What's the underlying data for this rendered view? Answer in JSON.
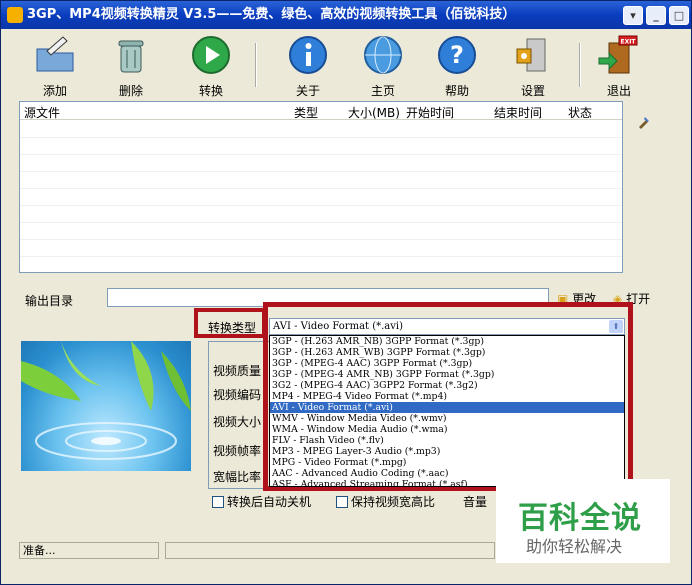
{
  "window": {
    "title": "3GP、MP4视频转换精灵 V3.5——免费、绿色、高效的视频转换工具（佰锐科技）"
  },
  "toolbar": {
    "add": "添加",
    "delete": "删除",
    "convert": "转换",
    "about": "关于",
    "home": "主页",
    "help": "帮助",
    "settings": "设置",
    "exit": "退出",
    "exit_sign": "EXIT"
  },
  "filelist": {
    "columns": [
      "源文件",
      "类型",
      "大小(MB)",
      "开始时间",
      "结束时间",
      "状态"
    ],
    "rows": []
  },
  "output": {
    "label": "输出目录",
    "value": "",
    "change": "更改",
    "open": "打开"
  },
  "conversion": {
    "type_label": "转换类型",
    "selected": "AVI - Video Format (*.avi)",
    "options": [
      "3GP - (H.263 AMR_NB) 3GPP Format (*.3gp)",
      "3GP - (H.263 AMR_WB) 3GPP Format (*.3gp)",
      "3GP - (MPEG-4 AAC) 3GPP Format (*.3gp)",
      "3GP - (MPEG-4 AMR_NB) 3GPP Format (*.3gp)",
      "3G2 - (MPEG-4 AAC) 3GPP2 Format (*.3g2)",
      "MP4 - MPEG-4 Video Format (*.mp4)",
      "AVI - Video Format (*.avi)",
      "WMV - Window Media Video (*.wmv)",
      "WMA - Window Media Audio (*.wma)",
      "FLV - Flash Video (*.flv)",
      "MP3 - MPEG Layer-3 Audio (*.mp3)",
      "MPG - Video Format (*.mpg)",
      "AAC - Advanced Audio Coding (*.aac)",
      "ASF - Advanced Streaming Format (*.asf)"
    ],
    "selected_index": 6
  },
  "params": {
    "quality": "视频质量",
    "codec": "视频编码",
    "size": "视频大小",
    "framerate": "视频帧率",
    "aspect": "宽幅比率"
  },
  "options": {
    "auto_shutdown": "转换后自动关机",
    "keep_aspect": "保持视频宽高比",
    "volume": "音量"
  },
  "status": {
    "text": "准备..."
  },
  "watermark": {
    "line1": "百科全说",
    "line2": "助你轻松解决"
  },
  "colors": {
    "titlebar": "#0a3dbe",
    "highlight": "#b0121b",
    "selection": "#316ac5",
    "watermark_green": "#2e9e48"
  }
}
